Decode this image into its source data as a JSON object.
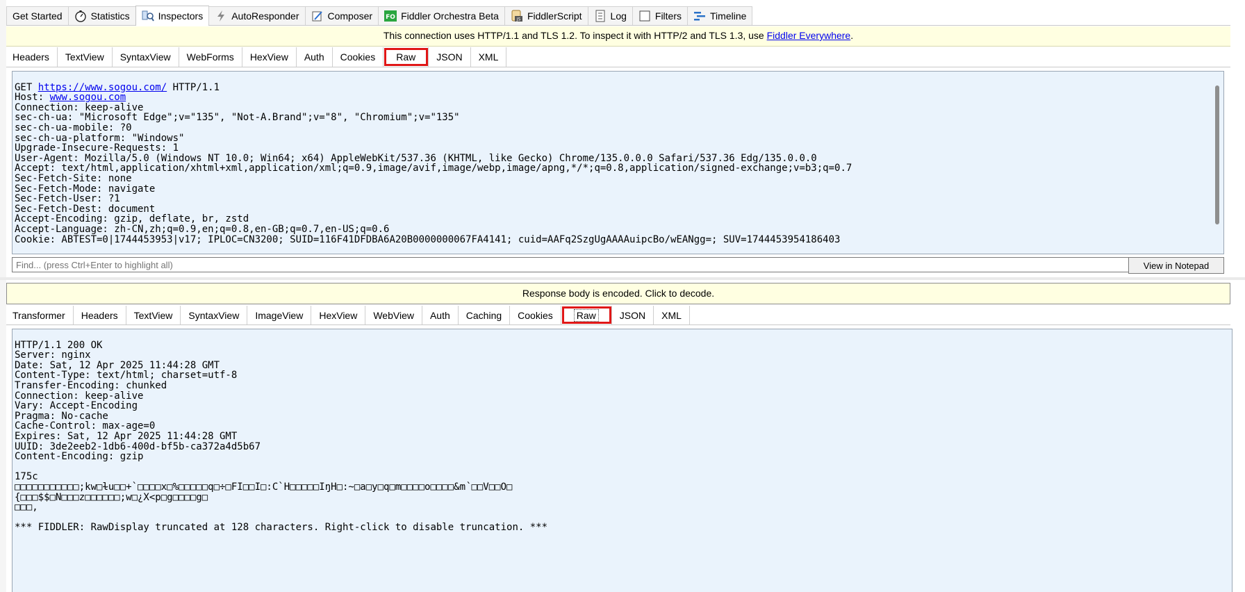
{
  "top_tabs": [
    {
      "label": "Get Started",
      "icon": ""
    },
    {
      "label": "Statistics",
      "icon": "stopwatch-icon"
    },
    {
      "label": "Inspectors",
      "icon": "inspectors-icon",
      "active": true
    },
    {
      "label": "AutoResponder",
      "icon": "lightning-icon"
    },
    {
      "label": "Composer",
      "icon": "composer-icon"
    },
    {
      "label": "Fiddler Orchestra Beta",
      "icon": "fo-icon"
    },
    {
      "label": "FiddlerScript",
      "icon": "script-icon"
    },
    {
      "label": "Log",
      "icon": "log-icon"
    },
    {
      "label": "Filters",
      "icon": "checkbox-icon"
    },
    {
      "label": "Timeline",
      "icon": "timeline-icon"
    }
  ],
  "connection_notice": {
    "text": "This connection uses HTTP/1.1 and TLS 1.2. To inspect it with HTTP/2 and TLS 1.3, use ",
    "link": "Fiddler Everywhere",
    "suffix": "."
  },
  "request_tabs": [
    "Headers",
    "TextView",
    "SyntaxView",
    "WebForms",
    "HexView",
    "Auth",
    "Cookies",
    "Raw",
    "JSON",
    "XML"
  ],
  "request_raw": {
    "first_prefix": "GET ",
    "first_url": "https://www.sogou.com/",
    "first_suffix": " HTTP/1.1",
    "host_prefix": "Host: ",
    "host_link": "www.sogou.com",
    "lines": [
      "Connection: keep-alive",
      "sec-ch-ua: \"Microsoft Edge\";v=\"135\", \"Not-A.Brand\";v=\"8\", \"Chromium\";v=\"135\"",
      "sec-ch-ua-mobile: ?0",
      "sec-ch-ua-platform: \"Windows\"",
      "Upgrade-Insecure-Requests: 1",
      "User-Agent: Mozilla/5.0 (Windows NT 10.0; Win64; x64) AppleWebKit/537.36 (KHTML, like Gecko) Chrome/135.0.0.0 Safari/537.36 Edg/135.0.0.0",
      "Accept: text/html,application/xhtml+xml,application/xml;q=0.9,image/avif,image/webp,image/apng,*/*;q=0.8,application/signed-exchange;v=b3;q=0.7",
      "Sec-Fetch-Site: none",
      "Sec-Fetch-Mode: navigate",
      "Sec-Fetch-User: ?1",
      "Sec-Fetch-Dest: document",
      "Accept-Encoding: gzip, deflate, br, zstd",
      "Accept-Language: zh-CN,zh;q=0.9,en;q=0.8,en-GB;q=0.7,en-US;q=0.6",
      "Cookie: ABTEST=0|1744453953|v17; IPLOC=CN3200; SUID=116F41DFDBA6A20B0000000067FA4141; cuid=AAFq2SzgUgAAAAuipcBo/wEANgg=; SUV=1744453954186403"
    ]
  },
  "find": {
    "placeholder": "Find... (press Ctrl+Enter to highlight all)",
    "button": "View in Notepad"
  },
  "encoded_notice": "Response body is encoded. Click to decode.",
  "response_tabs": [
    "Transformer",
    "Headers",
    "TextView",
    "SyntaxView",
    "ImageView",
    "HexView",
    "WebView",
    "Auth",
    "Caching",
    "Cookies",
    "Raw",
    "JSON",
    "XML"
  ],
  "response_raw": {
    "lines": [
      "HTTP/1.1 200 OK",
      "Server: nginx",
      "Date: Sat, 12 Apr 2025 11:44:28 GMT",
      "Content-Type: text/html; charset=utf-8",
      "Transfer-Encoding: chunked",
      "Connection: keep-alive",
      "Vary: Accept-Encoding",
      "Pragma: No-cache",
      "Cache-Control: max-age=0",
      "Expires: Sat, 12 Apr 2025 11:44:28 GMT",
      "UUID: 3de2eeb2-1db6-400d-bf5b-ca372a4d5b67",
      "Content-Encoding: gzip",
      "",
      "175c",
      "□□□□□□□□□□□;kw□ɫu□□+`□□□□x□%□□□□□q□÷□FI□□I□:C`H□□□□□IŋH□:~□a□y□q□m□□□□o□□□□&m՝□□V□□O□",
      "{□□□$$□N□□□z□□□□□□;w□¿X<p□g□□□□g□",
      "□□□,",
      "",
      "*** FIDDLER: RawDisplay truncated at 128 characters. Right-click to disable truncation. ***"
    ]
  }
}
